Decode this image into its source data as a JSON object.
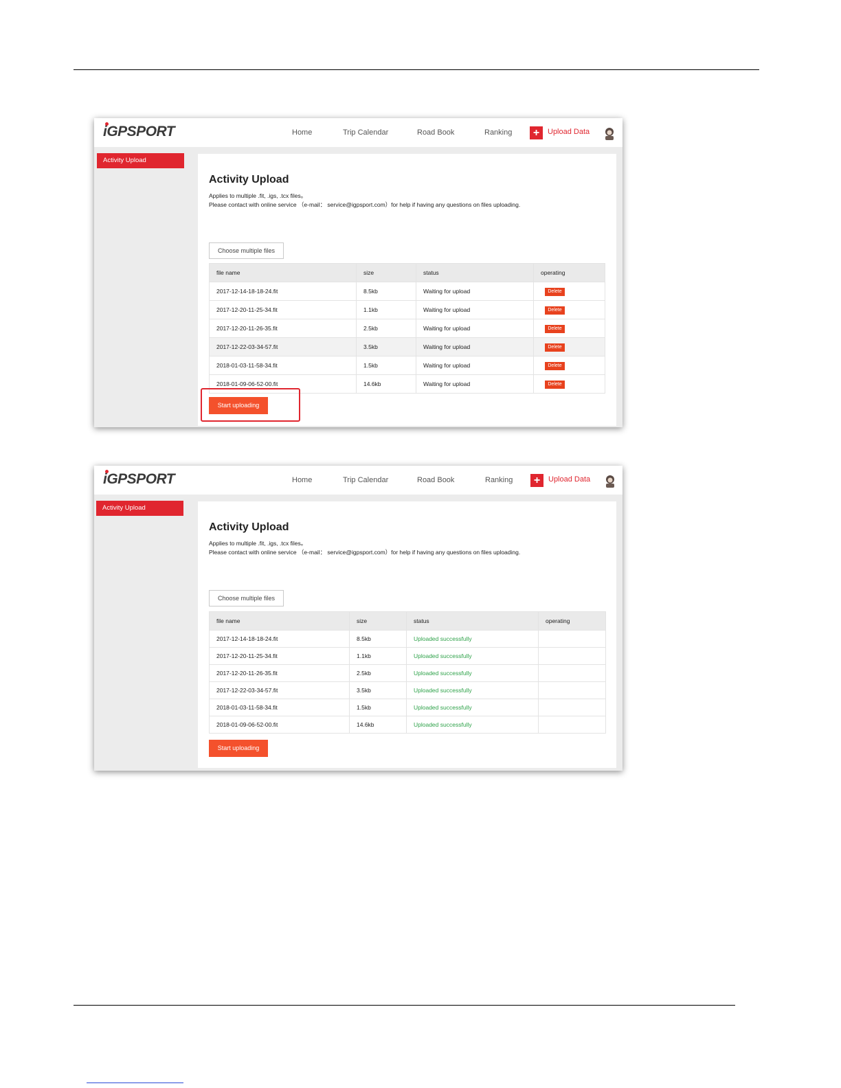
{
  "header_rule": "",
  "screens": [
    {
      "logo": "iGPSPORT",
      "nav": [
        "Home",
        "Trip Calendar",
        "Road Book",
        "Ranking"
      ],
      "upload_plus": "+",
      "upload_label": "Upload Data",
      "sidebar_item": "Activity Upload",
      "title": "Activity Upload",
      "desc1": "Applies to multiple .fit, .igs, .tcx files。",
      "desc2": "Please contact with online service （e-mail： service@igpsport.com）for help if having any questions on files uploading.",
      "choose_label": "Choose multiple files",
      "columns": [
        "file name",
        "size",
        "status",
        "operating"
      ],
      "rows": [
        {
          "name": "2017-12-14-18-18-24.fit",
          "size": "8.5kb",
          "status": "Waiting for upload",
          "op": "Delete"
        },
        {
          "name": "2017-12-20-11-25-34.fit",
          "size": "1.1kb",
          "status": "Waiting for upload",
          "op": "Delete"
        },
        {
          "name": "2017-12-20-11-26-35.fit",
          "size": "2.5kb",
          "status": "Waiting for upload",
          "op": "Delete"
        },
        {
          "name": "2017-12-22-03-34-57.fit",
          "size": "3.5kb",
          "status": "Waiting for upload",
          "op": "Delete"
        },
        {
          "name": "2018-01-03-11-58-34.fit",
          "size": "1.5kb",
          "status": "Waiting for upload",
          "op": "Delete"
        },
        {
          "name": "2018-01-09-06-52-00.fit",
          "size": "14.6kb",
          "status": "Waiting for upload",
          "op": "Delete"
        }
      ],
      "start_label": "Start uploading"
    },
    {
      "logo": "iGPSPORT",
      "nav": [
        "Home",
        "Trip Calendar",
        "Road Book",
        "Ranking"
      ],
      "upload_plus": "+",
      "upload_label": "Upload Data",
      "sidebar_item": "Activity Upload",
      "title": "Activity Upload",
      "desc1": "Applies to multiple .fit, .igs, .tcx files。",
      "desc2": "Please contact with online service （e-mail： service@igpsport.com）for help if having any questions on files uploading.",
      "choose_label": "Choose multiple files",
      "columns": [
        "file name",
        "size",
        "status",
        "operating"
      ],
      "rows": [
        {
          "name": "2017-12-14-18-18-24.fit",
          "size": "8.5kb",
          "status": "Uploaded successfully"
        },
        {
          "name": "2017-12-20-11-25-34.fit",
          "size": "1.1kb",
          "status": "Uploaded successfully"
        },
        {
          "name": "2017-12-20-11-26-35.fit",
          "size": "2.5kb",
          "status": "Uploaded successfully"
        },
        {
          "name": "2017-12-22-03-34-57.fit",
          "size": "3.5kb",
          "status": "Uploaded successfully"
        },
        {
          "name": "2018-01-03-11-58-34.fit",
          "size": "1.5kb",
          "status": "Uploaded successfully"
        },
        {
          "name": "2018-01-09-06-52-00.fit",
          "size": "14.6kb",
          "status": "Uploaded successfully"
        }
      ],
      "start_label": "Start uploading"
    }
  ],
  "colors": {
    "brand_red": "#e0262f",
    "button_orange": "#f4512c",
    "success_green": "#2fa24a"
  }
}
